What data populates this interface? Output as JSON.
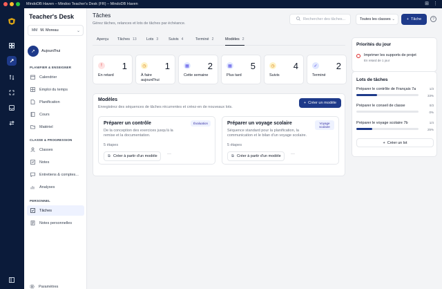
{
  "window": {
    "title": "MindoDB Haven – Mindoo Teacher's Desk (FR) – MindoDB Haven"
  },
  "brand": "Teacher's Desk",
  "user": {
    "initials": "MM",
    "name": "M. Moreau"
  },
  "today": {
    "label": "Aujourd'hui"
  },
  "sections": {
    "plan": "PLANIFIER & ENSEIGNER",
    "classe": "CLASSE & PROGRESSION",
    "perso": "PERSONNEL"
  },
  "nav_plan": [
    "Calendrier",
    "Emploi du temps",
    "Planification",
    "Cours",
    "Matériel"
  ],
  "nav_classe": [
    "Classes",
    "Notes",
    "Entretiens & comptes...",
    "Analyses"
  ],
  "nav_perso": [
    "Tâches",
    "Notes personnelles"
  ],
  "settings_label": "Paramètres",
  "header": {
    "title": "Tâches",
    "subtitle": "Gérez tâches, relances et lots de tâches par échéance.",
    "search_placeholder": "Rechercher des tâches...",
    "class_select": "Toutes les classes",
    "new_task": "Tâche"
  },
  "tabs": [
    {
      "label": "Aperçu",
      "count": ""
    },
    {
      "label": "Tâches",
      "count": "13"
    },
    {
      "label": "Lots",
      "count": "3"
    },
    {
      "label": "Suivis",
      "count": "4"
    },
    {
      "label": "Terminé",
      "count": "2"
    },
    {
      "label": "Modèles",
      "count": "2"
    }
  ],
  "stats": [
    {
      "label": "En retard",
      "value": "1",
      "color": "#dc2626",
      "bg": "#fee2e2"
    },
    {
      "label": "À faire aujourd'hui",
      "value": "1",
      "color": "#d97706",
      "bg": "#fef3c7"
    },
    {
      "label": "Cette semaine",
      "value": "2",
      "color": "#4f46e5",
      "bg": "#e0e7ff"
    },
    {
      "label": "Plus tard",
      "value": "5",
      "color": "#4f46e5",
      "bg": "#e0e7ff"
    },
    {
      "label": "Suivis",
      "value": "4",
      "color": "#d97706",
      "bg": "#fef3c7"
    },
    {
      "label": "Terminé",
      "value": "2",
      "color": "#4f46e5",
      "bg": "#e0e7ff"
    }
  ],
  "models": {
    "title": "Modèles",
    "subtitle": "Enregistrez des séquences de tâches récurrentes et créez-en de nouveaux lots.",
    "create_label": "Créer un modèle",
    "cards": [
      {
        "title": "Préparer un contrôle",
        "badge": "Évaluation",
        "description": "De la conception des exercices jusqu'à la remise et la documentation.",
        "steps": "5 étapes",
        "action": "Créer à partir d'un modèle"
      },
      {
        "title": "Préparer un voyage scolaire",
        "badge": "Voyage scolaire",
        "description": "Séquence standard pour la planification, la communication et le bilan d'un voyage scolaire.",
        "steps": "5 étapes",
        "action": "Créer à partir d'un modèle"
      }
    ]
  },
  "priorities": {
    "title": "Priorités du jour",
    "item": "Imprimer les supports de projet",
    "item_sub": "En retard de 1 jour"
  },
  "lots": {
    "title": "Lots de tâches",
    "items": [
      {
        "name": "Préparer le contrôle de Français 7a",
        "count": "1/3",
        "percent": "33%",
        "fraction": 0.33
      },
      {
        "name": "Préparer le conseil de classe",
        "count": "0/3",
        "percent": "0%",
        "fraction": 0
      },
      {
        "name": "Préparer le voyage scolaire 7b",
        "count": "1/4",
        "percent": "25%",
        "fraction": 0.25
      }
    ],
    "create_label": "Créer un lot"
  }
}
